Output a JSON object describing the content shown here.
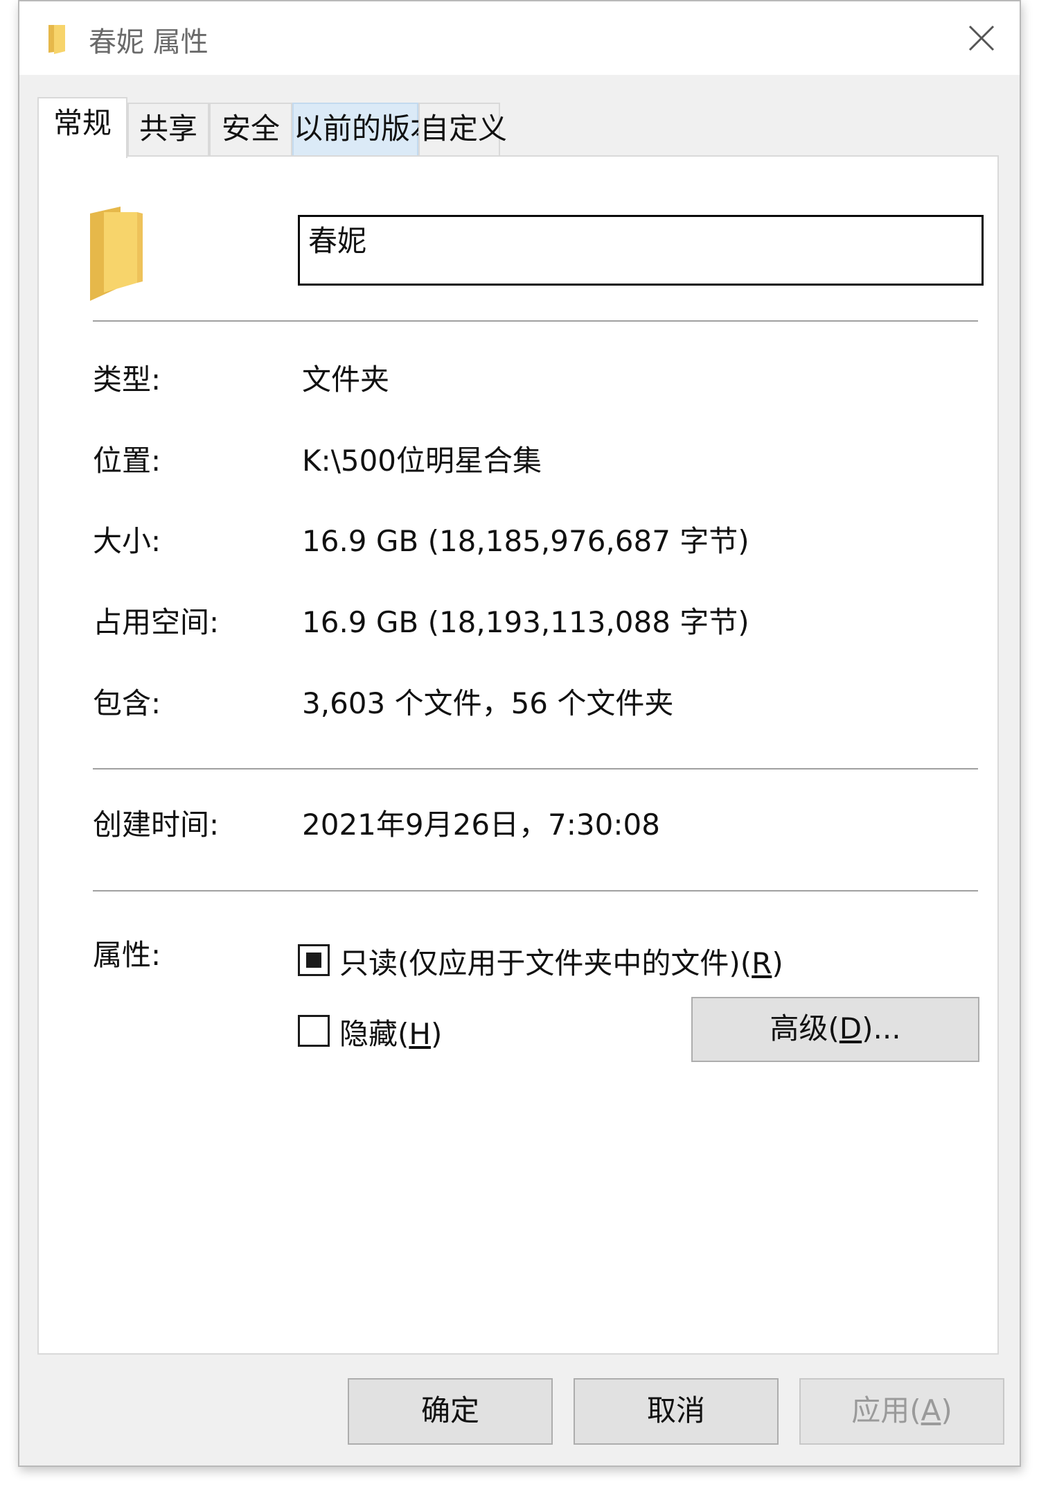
{
  "window": {
    "title": "春妮 属性",
    "close_icon": "close-icon"
  },
  "tabs": [
    {
      "label": "常规",
      "active": true
    },
    {
      "label": "共享"
    },
    {
      "label": "安全"
    },
    {
      "label": "以前的版本",
      "hover": true
    },
    {
      "label": "自定义"
    }
  ],
  "general": {
    "folder_icon": "folder-icon",
    "name_value": "春妮",
    "type_label": "类型:",
    "type_value": "文件夹",
    "location_label": "位置:",
    "location_value": "K:\\500位明星合集",
    "size_label": "大小:",
    "size_value": "16.9 GB (18,185,976,687 字节)",
    "disk_size_label": "占用空间:",
    "disk_size_value": "16.9 GB (18,193,113,088 字节)",
    "contains_label": "包含:",
    "contains_value": "3,603 个文件，56 个文件夹",
    "created_label": "创建时间:",
    "created_value": "2021年9月26日，7:30:08",
    "attributes_label": "属性:",
    "readonly": {
      "label_pre": "只读(仅应用于文件夹中的文件)(",
      "key": "R",
      "label_post": ")",
      "state": "indeterminate"
    },
    "hidden": {
      "label_pre": "隐藏(",
      "key": "H",
      "label_post": ")",
      "checked": false
    },
    "advanced_button": {
      "pre": "高级(",
      "key": "D",
      "post": ")..."
    }
  },
  "footer": {
    "ok": "确定",
    "cancel": "取消",
    "apply_pre": "应用(",
    "apply_key": "A",
    "apply_post": ")",
    "apply_disabled": true
  },
  "colors": {
    "folder_front": "#f7d46b",
    "folder_back": "#e6b84a",
    "tab_hover": "#dbeaf7"
  }
}
